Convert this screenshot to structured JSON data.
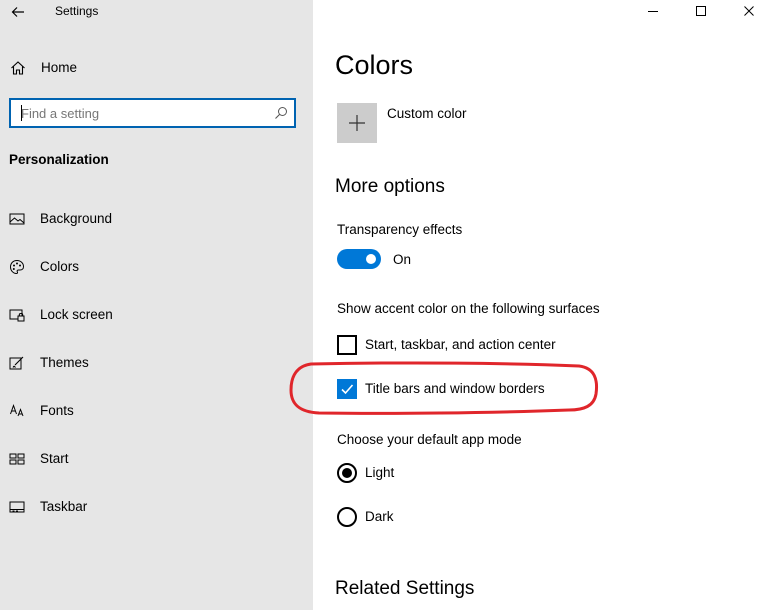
{
  "window": {
    "title": "Settings"
  },
  "sidebar": {
    "home_label": "Home",
    "search_placeholder": "Find a setting",
    "section_title": "Personalization",
    "items": [
      {
        "label": "Background",
        "icon": "picture-icon"
      },
      {
        "label": "Colors",
        "icon": "palette-icon"
      },
      {
        "label": "Lock screen",
        "icon": "lock-screen-icon"
      },
      {
        "label": "Themes",
        "icon": "themes-icon"
      },
      {
        "label": "Fonts",
        "icon": "fonts-icon"
      },
      {
        "label": "Start",
        "icon": "start-icon"
      },
      {
        "label": "Taskbar",
        "icon": "taskbar-icon"
      }
    ]
  },
  "main": {
    "title": "Colors",
    "custom_color_label": "Custom color",
    "more_options_title": "More options",
    "transparency_label": "Transparency effects",
    "transparency_state": "On",
    "transparency_on": true,
    "accent_surfaces_label": "Show accent color on the following surfaces",
    "surfaces": [
      {
        "label": "Start, taskbar, and action center",
        "checked": false
      },
      {
        "label": "Title bars and window borders",
        "checked": true
      }
    ],
    "app_mode_label": "Choose your default app mode",
    "app_modes": [
      {
        "label": "Light",
        "selected": true
      },
      {
        "label": "Dark",
        "selected": false
      }
    ],
    "related_settings_title": "Related Settings"
  },
  "colors": {
    "accent": "#0078d7",
    "sidebar_bg": "#e6e6e6",
    "annotation": "#e0262b"
  }
}
